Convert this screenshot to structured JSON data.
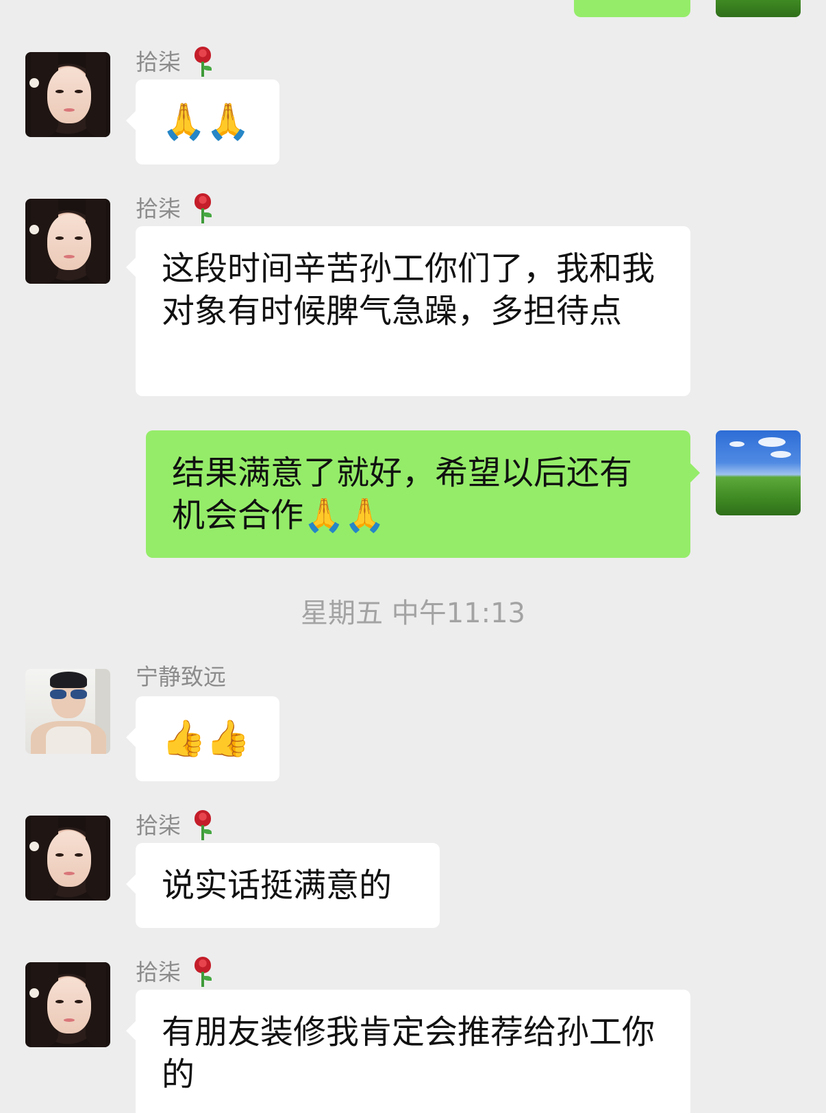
{
  "timestamp": "星期五 中午11:13",
  "messages": [
    {
      "sender": "拾柒",
      "sender_badge": "rose-emoji",
      "text": "🙏🙏"
    },
    {
      "sender": "拾柒",
      "sender_badge": "rose-emoji",
      "text": "这段时间辛苦孙工你们了，我和我对象有时候脾气急躁，多担待点"
    },
    {
      "sender": "me",
      "text": "结果满意了就好，希望以后还有机会合作🙏🙏"
    },
    {
      "sender": "宁静致远",
      "text": "👍👍"
    },
    {
      "sender": "拾柒",
      "sender_badge": "rose-emoji",
      "text": "说实话挺满意的"
    },
    {
      "sender": "拾柒",
      "sender_badge": "rose-emoji",
      "text": "有朋友装修我肯定会推荐给孙工你的"
    }
  ],
  "colors": {
    "background": "#ededed",
    "incoming_bubble": "#ffffff",
    "outgoing_bubble": "#95ec69",
    "name_text": "#8c8c8c",
    "timestamp_text": "#a3a3a3"
  }
}
